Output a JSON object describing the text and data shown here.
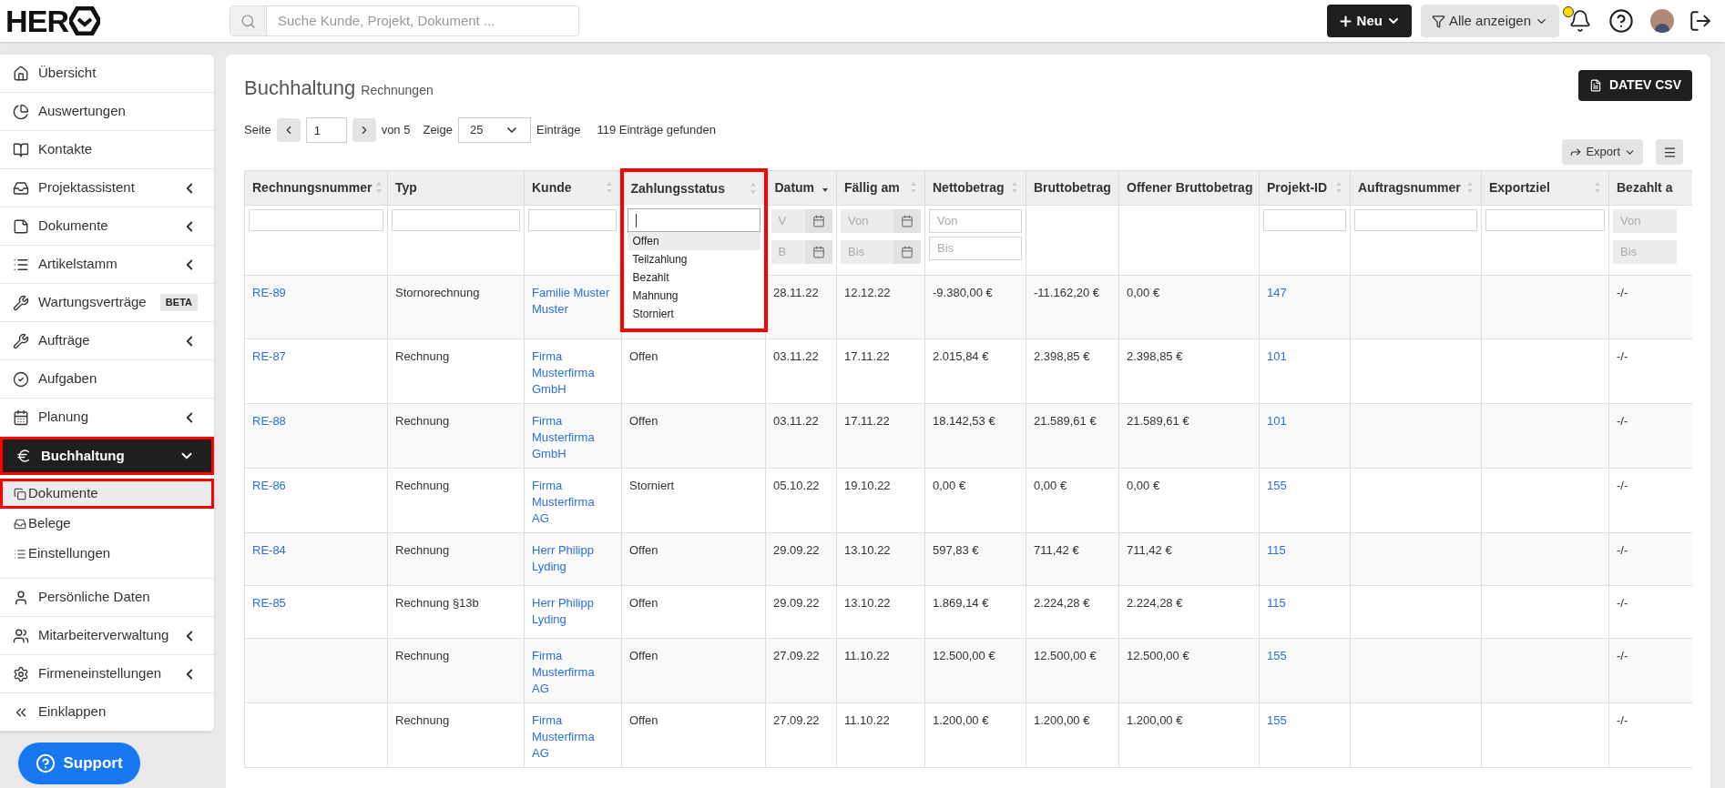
{
  "topbar": {
    "logo": "HER",
    "search": {
      "placeholder": "Suche Kunde, Projekt, Dokument ..."
    },
    "new_button": "Neu",
    "filter_button": "Alle anzeigen",
    "notification": true
  },
  "sidebar": {
    "items": [
      {
        "label": "Übersicht",
        "expandable": false,
        "selected": false
      },
      {
        "label": "Auswertungen",
        "expandable": false,
        "selected": false
      },
      {
        "label": "Kontakte",
        "expandable": false,
        "selected": false
      },
      {
        "label": "Projektassistent",
        "expandable": true,
        "selected": false
      },
      {
        "label": "Dokumente",
        "expandable": true,
        "selected": false
      },
      {
        "label": "Artikelstamm",
        "expandable": true,
        "selected": false
      },
      {
        "label": "Wartungsverträge",
        "expandable": false,
        "badge": "BETA",
        "selected": false
      },
      {
        "label": "Aufträge",
        "expandable": true,
        "selected": false
      },
      {
        "label": "Aufgaben",
        "expandable": false,
        "selected": false
      },
      {
        "label": "Planung",
        "expandable": true,
        "selected": false
      },
      {
        "label": "Buchhaltung",
        "expandable": true,
        "expanded": true,
        "selected": true,
        "children": [
          {
            "label": "Dokumente",
            "selected": true
          },
          {
            "label": "Belege",
            "selected": false
          },
          {
            "label": "Einstellungen",
            "selected": false
          }
        ]
      },
      {
        "label": "Persönliche Daten",
        "expandable": false,
        "selected": false
      },
      {
        "label": "Mitarbeiterverwaltung",
        "expandable": true,
        "selected": false
      },
      {
        "label": "Firmeneinstellungen",
        "expandable": true,
        "selected": false
      },
      {
        "label": "Einklappen",
        "expandable": false,
        "selected": false
      }
    ],
    "support_button": "Support"
  },
  "page": {
    "title": "Buchhaltung",
    "subtitle": "Rechnungen",
    "datev_button": "DATEV CSV",
    "pagination": {
      "page_label": "Seite",
      "page": "1",
      "of": "von 5",
      "show_label": "Zeige",
      "page_size": "25",
      "entries_label": "Einträge",
      "found": "119 Einträge gefunden"
    },
    "export_button": "Export"
  },
  "table": {
    "columns": [
      {
        "label": "Rechnungsnummer",
        "sortable": true,
        "sorted": false,
        "kind": "text"
      },
      {
        "label": "Typ",
        "kind": "text"
      },
      {
        "label": "Kunde",
        "sortable": true,
        "sorted": false,
        "kind": "text"
      },
      {
        "label": "Zahlungsstatus",
        "sortable": true,
        "sorted": false,
        "kind": "select"
      },
      {
        "label": "Datum",
        "sortable": true,
        "sorted": true,
        "kind": "date",
        "filters": [
          {
            "placeholder": "V"
          },
          {
            "placeholder": "B"
          }
        ]
      },
      {
        "label": "Fällig am",
        "sortable": true,
        "sorted": false,
        "kind": "date",
        "filters": [
          {
            "placeholder": "Von"
          },
          {
            "placeholder": "Bis"
          }
        ]
      },
      {
        "label": "Nettobetrag",
        "sortable": true,
        "sorted": false,
        "kind": "range",
        "filters": [
          {
            "placeholder": "Von"
          },
          {
            "placeholder": "Bis"
          }
        ]
      },
      {
        "label": "Bruttobetrag",
        "kind": "none"
      },
      {
        "label": "Offener Bruttobetrag",
        "kind": "none"
      },
      {
        "label": "Projekt-ID",
        "sortable": true,
        "sorted": false,
        "kind": "text"
      },
      {
        "label": "Auftragsnummer",
        "sortable": true,
        "sorted": false,
        "kind": "text"
      },
      {
        "label": "Exportziel",
        "sortable": true,
        "sorted": false,
        "kind": "text"
      },
      {
        "label": "Bezahlt a",
        "kind": "datecut",
        "filters": [
          {
            "placeholder": "Von"
          },
          {
            "placeholder": "Bis"
          }
        ]
      }
    ],
    "status_dropdown": {
      "options": [
        {
          "label": "Offen",
          "selected": true
        },
        {
          "label": "Teilzahlung",
          "selected": false
        },
        {
          "label": "Bezahlt",
          "selected": false
        },
        {
          "label": "Mahnung",
          "selected": false
        },
        {
          "label": "Storniert",
          "selected": false
        }
      ]
    },
    "rows": [
      [
        "RE-89",
        "Stornorechnung",
        "Familie Muster Muster",
        null,
        "28.11.22",
        "12.12.22",
        "-9.380,00 €",
        "-11.162,20 €",
        "0,00 €",
        "147",
        null,
        null,
        "-/-"
      ],
      [
        "RE-87",
        "Rechnung",
        "Firma Musterfirma GmbH",
        "Offen",
        "03.11.22",
        "17.11.22",
        "2.015,84 €",
        "2.398,85 €",
        "2.398,85 €",
        "101",
        null,
        null,
        "-/-"
      ],
      [
        "RE-88",
        "Rechnung",
        "Firma Musterfirma GmbH",
        "Offen",
        "03.11.22",
        "17.11.22",
        "18.142,53 €",
        "21.589,61 €",
        "21.589,61 €",
        "101",
        null,
        null,
        "-/-"
      ],
      [
        "RE-86",
        "Rechnung",
        "Firma Musterfirma AG",
        "Storniert",
        "05.10.22",
        "19.10.22",
        "0,00 €",
        "0,00 €",
        "0,00 €",
        "155",
        null,
        null,
        "-/-"
      ],
      [
        "RE-84",
        "Rechnung",
        "Herr Philipp Lyding",
        "Offen",
        "29.09.22",
        "13.10.22",
        "597,83 €",
        "711,42 €",
        "711,42 €",
        "115",
        null,
        null,
        "-/-"
      ],
      [
        "RE-85",
        "Rechnung §13b",
        "Herr Philipp Lyding",
        "Offen",
        "29.09.22",
        "13.10.22",
        "1.869,14 €",
        "2.224,28 €",
        "2.224,28 €",
        "115",
        null,
        null,
        "-/-"
      ],
      [
        null,
        "Rechnung",
        "Firma Musterfirma AG",
        "Offen",
        "27.09.22",
        "11.10.22",
        "12.500,00 €",
        "12.500,00 €",
        "12.500,00 €",
        "155",
        null,
        null,
        "-/-"
      ],
      [
        null,
        "Rechnung",
        "Firma Musterfirma AG",
        "Offen",
        "27.09.22",
        "11.10.22",
        "1.200,00 €",
        "1.200,00 €",
        "1.200,00 €",
        "155",
        null,
        null,
        "-/-"
      ]
    ]
  }
}
